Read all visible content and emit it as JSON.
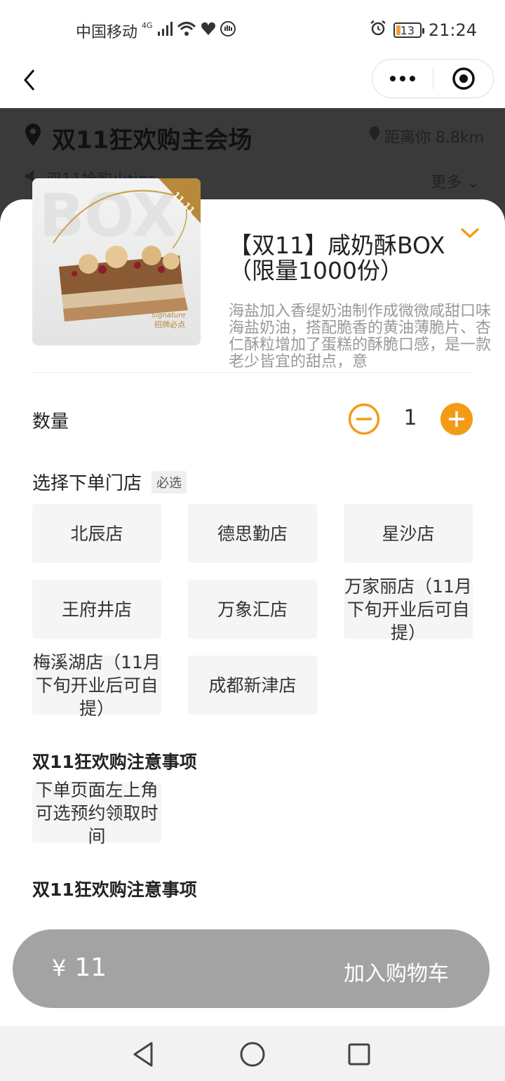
{
  "status_bar": {
    "carrier": "中国移动",
    "network": "4G",
    "battery": "13",
    "time": "21:24"
  },
  "nav": {
    "back_icon": "back-arrow-icon",
    "more_icon": "more-dots-icon",
    "close_icon": "target-circle-icon"
  },
  "background_page": {
    "title": "双11狂欢购主会场",
    "distance": "距离你 8.8km",
    "notice": "双11抢购小tips",
    "more": "更多"
  },
  "product": {
    "name": "【双11】咸奶酥BOX（限量1000份）",
    "description": "海盐加入香缇奶油制作成微微咸甜口味海盐奶油，搭配脆香的黄油薄脆片、杏仁酥粒增加了蛋糕的酥脆口感，是一款老少皆宜的甜点，意",
    "image_box_text": "BOX",
    "image_badge": "11.11",
    "image_sig": "Signature",
    "image_sig_cn": "招牌必点",
    "accent_color": "#f39b17"
  },
  "quantity": {
    "label": "数量",
    "value": "1"
  },
  "store_select": {
    "label": "选择下单门店",
    "required": "必选",
    "stores": [
      "北辰店",
      "德思勤店",
      "星沙店",
      "王府井店",
      "万象汇店",
      "万家丽店（11月下旬开业后可自提）",
      "梅溪湖店（11月下旬开业后可自提）",
      "成都新津店"
    ]
  },
  "notices": [
    {
      "title": "双11狂欢购注意事项",
      "option": "下单页面左上角可选预约领取时间"
    },
    {
      "title": "双11狂欢购注意事项"
    }
  ],
  "cart": {
    "currency": "¥",
    "price": "11",
    "button": "加入购物车"
  }
}
